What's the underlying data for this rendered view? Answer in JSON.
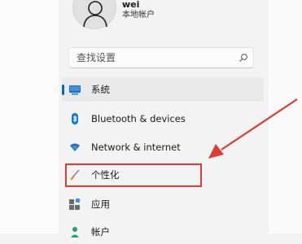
{
  "profile": {
    "name": "wei",
    "account_type": "本地帐户"
  },
  "search": {
    "placeholder": "查找设置"
  },
  "nav": {
    "items": [
      {
        "label": "系统",
        "icon": "monitor-icon",
        "selected": true
      },
      {
        "label": "Bluetooth & devices",
        "icon": "bluetooth-icon"
      },
      {
        "label": "Network & internet",
        "icon": "wifi-icon"
      },
      {
        "label": "个性化",
        "icon": "brush-icon",
        "highlighted": true
      },
      {
        "label": "应用",
        "icon": "apps-icon"
      },
      {
        "label": "帐户",
        "icon": "account-icon"
      }
    ]
  },
  "colors": {
    "accent": "#0067c0",
    "annotation": "#e03a35",
    "selected_bg": "#e9e9e9"
  }
}
